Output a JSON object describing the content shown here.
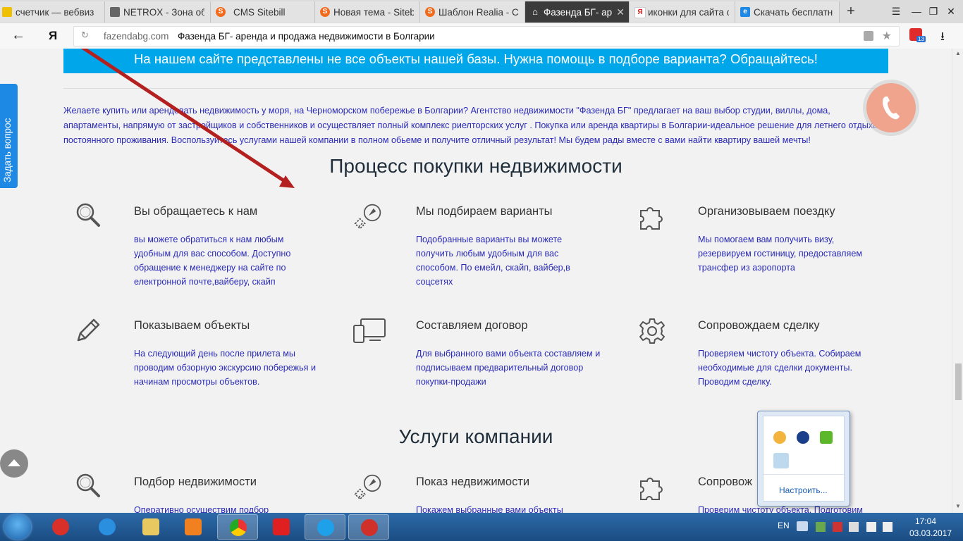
{
  "browser": {
    "tabs": [
      {
        "title": "счетчик — вебвиз",
        "favicon_color": "#f0c000"
      },
      {
        "title": "NETROX - Зона об",
        "favicon_color": "#666666"
      },
      {
        "title": "CMS Sitebill",
        "favicon_color": "#f26b1d"
      },
      {
        "title": "Новая тема - Siteb",
        "favicon_color": "#f26b1d"
      },
      {
        "title": "Шаблон Realia - Ст",
        "favicon_color": "#f26b1d"
      },
      {
        "title": "Фазенда БГ- аре",
        "favicon_color": "#ffffff",
        "active": true
      },
      {
        "title": "иконки для сайта с",
        "favicon_color": "#e02020"
      },
      {
        "title": "Скачать бесплатны",
        "favicon_color": "#1e88e5"
      }
    ],
    "tab_close": "✕",
    "new_tab": "+",
    "yandex_logo": "Я",
    "url_host": "fazendabg.com",
    "url_title": "Фазенда БГ- аренда и продажа недвижимости в Болгарии",
    "extension_badge": "13"
  },
  "page": {
    "banner": "На нашем сайте представлены не все объекты нашей базы. Нужна помощь в подборе варианта? Обращайтесь!",
    "intro": "Желаете купить или арендовать недвижимость у моря, на Черноморском побережье в Болгарии? Агентство недвижимости \"Фазенда БГ\" предлагает на ваш выбор студии, виллы, дома, апартаменты, напрямую от застройщиков и собственников и осуществляет полный комплекс риелторских услуг . Покупка или аренда квартиры в Болгарии-идеальное решение для летнего отдыха и постоянного проживания. Воспользуйтесь услугами нашей компании в полном обьеме и получите отличный результат! Мы будем рады вместе с вами найти квартиру вашей мечты!",
    "process_title": "Процесс покупки недвижимости",
    "process": [
      {
        "icon": "search-icon",
        "title": "Вы обращаетесь к нам",
        "desc": "вы можете обратиться к нам любым удобным для вас способом. Доступно обращение к менеджеру на сайте по електронной почте,вайберу, скайп"
      },
      {
        "icon": "compass-icon",
        "title": "Мы подбираем варианты",
        "desc": "Подобранные варианты вы можете получить любым удобным для вас способом. По емейл, скайп, вайбер,в соцсетях"
      },
      {
        "icon": "puzzle-icon",
        "title": "Организовываем поездку",
        "desc": "Мы помогаем вам получить визу, резервируем гостиницу, предоставляем трансфер из аэропорта"
      },
      {
        "icon": "pencil-icon",
        "title": "Показываем объекты",
        "desc": "На следующий день после прилета мы проводим обзорную экскурсию побережья и начинам просмотры объектов."
      },
      {
        "icon": "devices-icon",
        "title": "Составляем договор",
        "desc": "Для выбранного вами объекта составляем и подписываем предварительный договор покупки-продажи"
      },
      {
        "icon": "gear-icon",
        "title": "Сопровождаем сделку",
        "desc": "Проверяем чистоту объекта. Собираем необходимые для сделки документы. Проводим сделку."
      }
    ],
    "services_title": "Услуги компании",
    "services": [
      {
        "icon": "search-icon",
        "title": "Подбор недвижимости",
        "desc": "Оперативно осуществим подбор"
      },
      {
        "icon": "compass-icon",
        "title": "Показ недвижимости",
        "desc": "Покажем выбранные вами объекты"
      },
      {
        "icon": "puzzle-icon",
        "title": "Сопровож",
        "desc": "Проверим чистоту объекта. Подготовим"
      }
    ],
    "side_tab": "Задать вопрос",
    "accent_color": "#00a6ea"
  },
  "tray_popup": {
    "customize_link": "Настроить..."
  },
  "taskbar": {
    "lang": "EN",
    "time": "17:04",
    "date": "03.03.2017"
  }
}
